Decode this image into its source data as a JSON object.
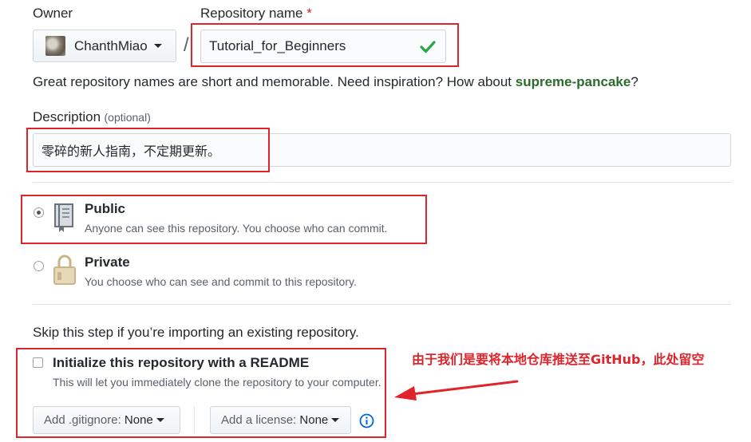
{
  "owner": {
    "label": "Owner",
    "username": "ChanthMiao"
  },
  "separator": "/",
  "repo_name": {
    "label": "Repository name",
    "required_mark": "*",
    "value": "Tutorial_for_Beginners"
  },
  "hint": {
    "prefix": "Great repository names are short and memorable. Need inspiration? How about ",
    "suggestion": "supreme-pancake",
    "suffix": "?"
  },
  "description": {
    "label": "Description",
    "optional": "(optional)",
    "value": "零碎的新人指南，不定期更新。"
  },
  "visibility": {
    "public": {
      "title": "Public",
      "desc": "Anyone can see this repository. You choose who can commit.",
      "selected": true
    },
    "private": {
      "title": "Private",
      "desc": "You choose who can see and commit to this repository.",
      "selected": false
    }
  },
  "skip_text": "Skip this step if you’re importing an existing repository.",
  "readme": {
    "title": "Initialize this repository with a README",
    "desc": "This will let you immediately clone the repository to your computer.",
    "checked": false
  },
  "gitignore": {
    "label": "Add .gitignore:",
    "value": "None"
  },
  "license": {
    "label": "Add a license:",
    "value": "None"
  },
  "annotation": {
    "text": "由于我们是要将本地仓库推送至GitHub，此处留空"
  },
  "colors": {
    "annotation_red": "#e0242b",
    "check_green": "#28a745",
    "suggestion_green": "#2d6a2d",
    "info_blue": "#0366d6"
  }
}
